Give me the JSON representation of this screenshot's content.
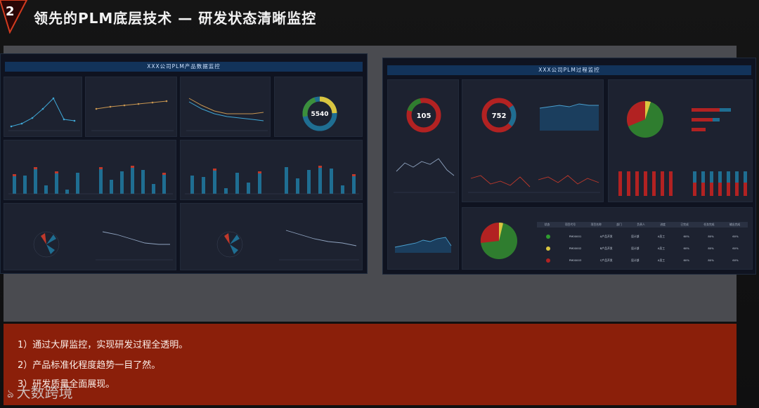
{
  "slide": {
    "number": "2",
    "title": "领先的PLM底层技术 — 研发状态清晰监控"
  },
  "left_panel": {
    "title": "XXX公司PLM产品数据监控",
    "ring_value": "5540"
  },
  "right_panel": {
    "title": "XXX公司PLM过程监控",
    "ring1_value": "105",
    "ring2_value": "752",
    "table_headers": [
      "状态",
      "项目代号",
      "项目名称",
      "部门",
      "负责人",
      "进度",
      "已完成",
      "任务完成",
      "输出完成"
    ],
    "table_rows": [
      {
        "status": "green",
        "code": "PM00001",
        "name": "A产品开发",
        "dept": "设计部",
        "owner": "A员工",
        "done": "60%",
        "p1": "80%",
        "p2": "60%"
      },
      {
        "status": "yellow",
        "code": "PM00002",
        "name": "B产品开发",
        "dept": "设计部",
        "owner": "A员工",
        "done": "60%",
        "p1": "80%",
        "p2": "60%"
      },
      {
        "status": "red",
        "code": "PM00003",
        "name": "C产品开发",
        "dept": "设计部",
        "owner": "A员工",
        "done": "60%",
        "p1": "80%",
        "p2": "60%"
      }
    ]
  },
  "footer": {
    "lines": [
      "1）通过大屏监控，实现研发过程全透明。",
      "2）产品标准化程度趋势一目了然。",
      "3）研发质量全面展现。"
    ]
  },
  "watermark": "大数跨境",
  "colors": {
    "accent_red": "#8b1f0a",
    "panel_bg": "#0f1320",
    "card_bg": "#1d2230",
    "header_bar": "#12335a",
    "ring_green": "#2f7d2f",
    "ring_red": "#b22222",
    "ring_yellow": "#d9c540",
    "ring_blue": "#1f6e92"
  }
}
